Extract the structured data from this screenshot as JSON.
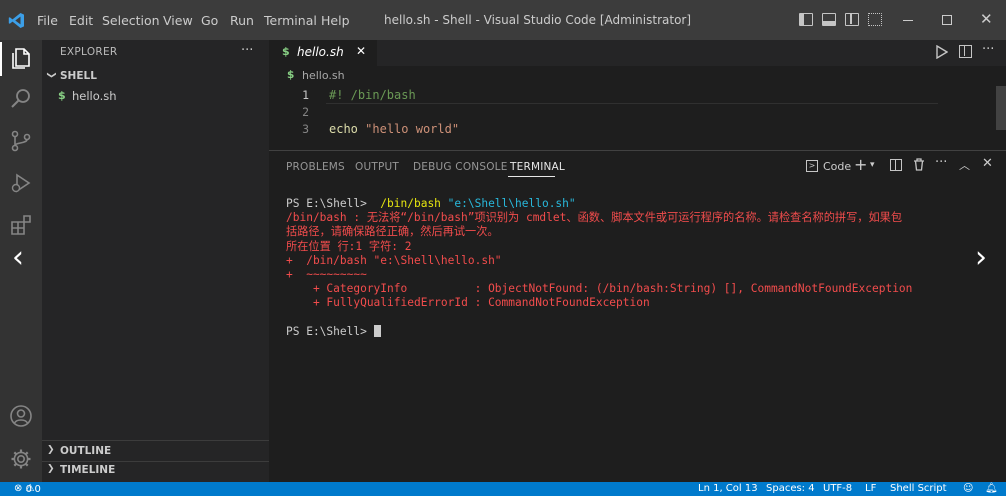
{
  "window": {
    "title": "hello.sh - Shell - Visual Studio Code [Administrator]",
    "menu": [
      "File",
      "Edit",
      "Selection",
      "View",
      "Go",
      "Run",
      "Terminal",
      "Help"
    ]
  },
  "sidebar": {
    "header": "EXPLORER",
    "folder": "SHELL",
    "files": [
      {
        "icon": "$",
        "name": "hello.sh"
      }
    ],
    "outline": "OUTLINE",
    "timeline": "TIMELINE",
    "more": "···"
  },
  "editor": {
    "tab": {
      "icon": "$",
      "label": "hello.sh",
      "close": "✕"
    },
    "breadcrumb": {
      "icon": "$",
      "label": "hello.sh"
    },
    "lines": [
      {
        "num": "1",
        "text": "#! /bin/bash"
      },
      {
        "num": "2",
        "text": ""
      },
      {
        "num": "3",
        "keyword": "echo",
        "string": "\"hello world\""
      }
    ]
  },
  "panel": {
    "tabs": [
      "PROBLEMS",
      "OUTPUT",
      "DEBUG CONSOLE",
      "TERMINAL"
    ],
    "active_tab": "TERMINAL",
    "terminal_name": "Code",
    "terminal": {
      "prompt": "PS E:\\Shell> ",
      "command": " /bin/bash",
      "arg": " \"e:\\Shell\\hello.sh\"",
      "error1": "/bin/bash : 无法将“/bin/bash”项识别为 cmdlet、函数、脚本文件或可运行程序的名称。请检查名称的拼写，如果包",
      "error2": "括路径，请确保路径正确，然后再试一次。",
      "error3": "所在位置 行:1 字符: 2",
      "error4": "+  /bin/bash \"e:\\Shell\\hello.sh\"",
      "error5": "+  ~~~~~~~~~",
      "error6": "    + CategoryInfo          : ObjectNotFound: (/bin/bash:String) [], CommandNotFoundException",
      "error7": "    + FullyQualifiedErrorId : CommandNotFoundException",
      "prompt2": "PS E:\\Shell> "
    }
  },
  "status": {
    "errors": "0",
    "warnings": "0",
    "position": "Ln 1, Col 13",
    "spaces": "Spaces: 4",
    "encoding": "UTF-8",
    "eol": "LF",
    "language": "Shell Script"
  },
  "colors": {
    "accent": "#007acc",
    "error": "#f14c4c",
    "command": "#e5e510",
    "string_arg": "#29b8db",
    "comment": "#6a9955",
    "keyword": "#dcdcaa",
    "string": "#ce9178",
    "shell_icon": "#89d185"
  }
}
